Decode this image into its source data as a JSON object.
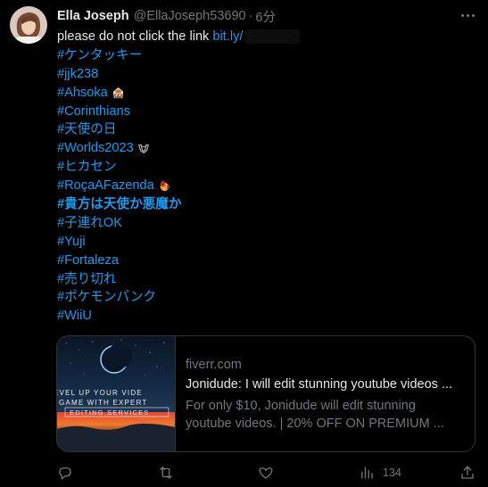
{
  "tweet": {
    "author_name": "Ella Joseph",
    "handle": "@EllaJoseph53690",
    "separator": "·",
    "time": "6分",
    "text_lead": "please do not click the link",
    "link": "bit.ly/",
    "hashtags": [
      {
        "text": "#ケンタッキー"
      },
      {
        "text": "#jjk238"
      },
      {
        "text": "#Ahsoka"
      },
      {
        "text": "#Corinthians"
      },
      {
        "text": "#天使の日"
      },
      {
        "text": "#Worlds2023"
      },
      {
        "text": "#ヒカセン"
      },
      {
        "text": "#RoçaAFazenda"
      },
      {
        "text": "#貴方は天使か悪魔か"
      },
      {
        "text": "#子連れOK"
      },
      {
        "text": "#Yuji"
      },
      {
        "text": "#Fortaleza"
      },
      {
        "text": "#売り切れ"
      },
      {
        "text": "#ポケモンパンク"
      },
      {
        "text": "#WiiU"
      }
    ]
  },
  "card": {
    "domain": "fiverr.com",
    "title": "Jonidude: I will edit stunning youtube videos ...",
    "description_line1": "For only $10, Jonidude will edit stunning",
    "description_line2": "youtube videos. | 20% OFF ON PREMIUM ...",
    "thumbnail_text_line1": "EVEL UP YOUR VIDE",
    "thumbnail_text_line2": "GAME WITH EXPERT",
    "thumbnail_text_line3": "EDITING SERVICES"
  },
  "actions": {
    "views_count": "134"
  },
  "icons": {
    "reply": "reply-icon",
    "retweet": "retweet-icon",
    "like": "heart-icon",
    "views": "views-icon",
    "share": "share-icon",
    "more": "more-icon"
  },
  "colors": {
    "background": "#000000",
    "link": "#1d9bf0",
    "text": "#e7e9ea",
    "muted": "#71767b",
    "border": "#2f3336"
  }
}
